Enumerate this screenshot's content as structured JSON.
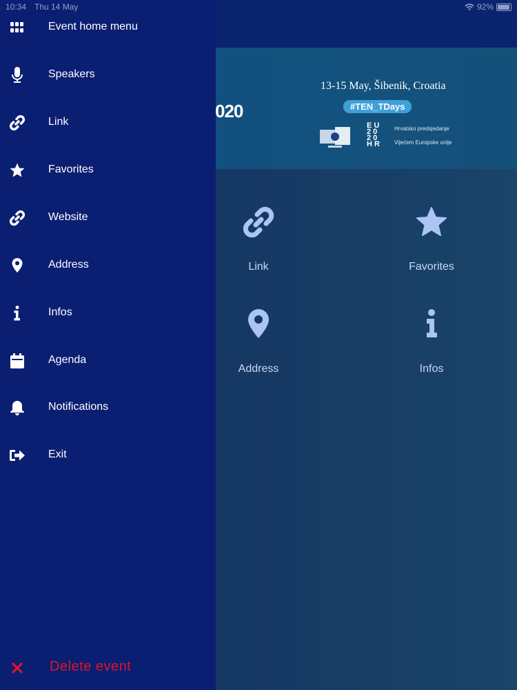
{
  "status_bar": {
    "time": "10:34",
    "date": "Thu 14 May",
    "battery": "92%",
    "battery_level": 0.92
  },
  "banner": {
    "year_fragment": "020",
    "date_location": "13-15 May, Šibenik, Croatia",
    "hashtag": "#TEN_TDays",
    "eu2020_mark": [
      "E U",
      "2 0",
      "2 0",
      "H R"
    ],
    "presidency_lines": [
      "Hrvatsko predsjedanje",
      "Vijećem Europske unije"
    ]
  },
  "grid": [
    {
      "label": "Link",
      "icon": "link-icon"
    },
    {
      "label": "Favorites",
      "icon": "star-icon"
    },
    {
      "label": "Address",
      "icon": "map-pin-icon"
    },
    {
      "label": "Infos",
      "icon": "info-icon"
    }
  ],
  "drawer": {
    "items": [
      {
        "label": "Event home menu",
        "icon": "grid-icon"
      },
      {
        "label": "Speakers",
        "icon": "microphone-icon"
      },
      {
        "label": "Link",
        "icon": "link-icon"
      },
      {
        "label": "Favorites",
        "icon": "star-icon"
      },
      {
        "label": "Website",
        "icon": "link-icon"
      },
      {
        "label": "Address",
        "icon": "map-pin-icon"
      },
      {
        "label": "Infos",
        "icon": "info-icon"
      },
      {
        "label": "Agenda",
        "icon": "calendar-icon"
      },
      {
        "label": "Notifications",
        "icon": "bell-icon"
      },
      {
        "label": "Exit",
        "icon": "sign-out-icon"
      }
    ],
    "delete_label": "Delete event",
    "delete_icon": "close-icon"
  },
  "colors": {
    "drawer_bg": "#0a1f72",
    "delete_red": "#e0142a",
    "hashtag_bg": "#3ea0d8",
    "tile_icon": "#a9c4f5"
  }
}
